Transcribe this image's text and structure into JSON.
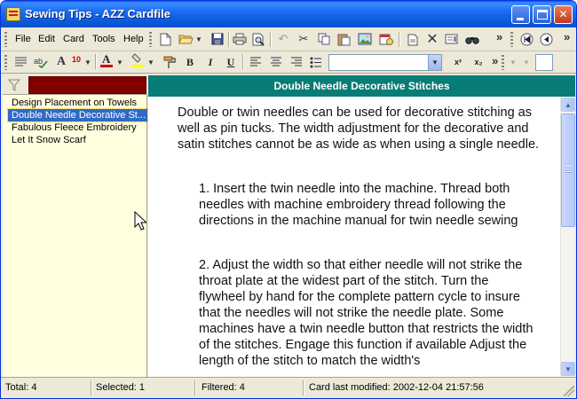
{
  "window": {
    "title": "Sewing Tips - AZZ Cardfile",
    "minimize_icon": "minimize-icon",
    "maximize_icon": "maximize-icon",
    "close_glyph": "✕"
  },
  "menu": {
    "items": [
      "File",
      "Edit",
      "Card",
      "Tools",
      "Help"
    ]
  },
  "toolbar1": {
    "icons": [
      "new-card-icon",
      "open-folder-icon",
      "dropdown-arrow-icon",
      "save-icon",
      "print-icon",
      "print-preview-icon",
      "undo-icon",
      "cut-icon",
      "copy-icon",
      "paste-icon",
      "insert-picture-icon",
      "insert-date-icon",
      "new-item-icon",
      "delete-icon",
      "properties-icon",
      "find-icon",
      "first-card-icon",
      "previous-card-icon"
    ],
    "overflow_glyph": "»"
  },
  "toolbar2": {
    "font_size": "10",
    "bold": "B",
    "italic": "I",
    "underline": "U",
    "superscript": "x²",
    "subscript": "x₂",
    "font_color": "#cc0000",
    "highlight_color": "#ffff00",
    "style_value": "",
    "overflow_glyph": "»"
  },
  "left_pane": {
    "filter_color": "#800000",
    "cards": [
      {
        "label": "Design Placement on Towels",
        "selected": false
      },
      {
        "label": "Double Needle Decorative St...",
        "selected": true
      },
      {
        "label": "Fabulous Fleece Embroidery",
        "selected": false
      },
      {
        "label": "Let It Snow Scarf",
        "selected": false
      }
    ]
  },
  "card": {
    "title": "Double Needle Decorative Stitches",
    "header_color": "#087c76",
    "paragraphs": [
      "Double or twin needles can be used for decorative stitching as well as pin tucks. The width adjustment for the decorative and satin stitches cannot be as wide as when using a single needle.",
      "1. Insert the twin needle into the machine. Thread both needles with machine embroidery thread following the directions in the machine manual for twin needle sewing",
      "2. Adjust the width so that either needle will not strike the throat plate at the widest part of the stitch. Turn the flywheel by hand for the complete pattern cycle to insure that the needles will not strike the needle plate. Some machines have a twin needle button that restricts the width of the stitches. Engage this function if available Adjust the length of the stitch to match the width's"
    ]
  },
  "status": {
    "total": "Total: 4",
    "selected": "Selected: 1",
    "filtered": "Filtered: 4",
    "modified": "Card last modified: 2002-12-04  21:57:56"
  }
}
